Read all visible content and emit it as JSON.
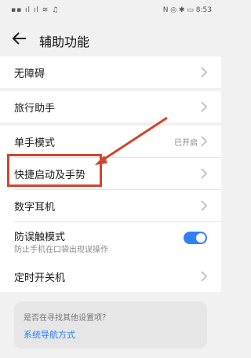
{
  "status_bar": {
    "left_indicators": "▪▪ ıl ıl ≋ ♫",
    "right_indicators": "N ◎ ✱ ▭",
    "time": "8:53"
  },
  "header": {
    "title": "辅助功能"
  },
  "settings": {
    "items": [
      {
        "label": "无障碍"
      },
      {
        "label": "旅行助手"
      },
      {
        "label": "单手模式",
        "status": "已开启"
      },
      {
        "label": "快捷启动及手势"
      },
      {
        "label": "数字耳机"
      },
      {
        "label": "防误触模式",
        "subtitle": "防止手机在口袋出现误操作",
        "toggle_on": true
      },
      {
        "label": "定时开关机"
      }
    ]
  },
  "help": {
    "question": "是否在寻找其他设置项？",
    "link": "系统导航方式"
  },
  "colors": {
    "accent": "#2f7ff5",
    "annotation": "#d3452c"
  }
}
